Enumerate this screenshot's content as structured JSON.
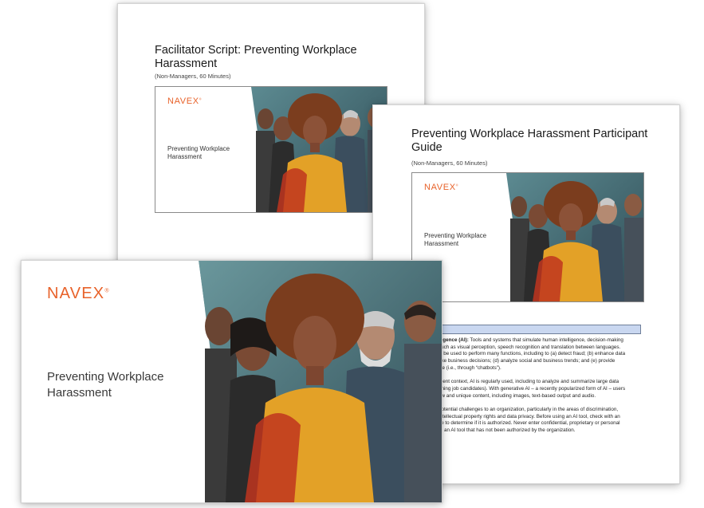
{
  "brand": {
    "logo_text": "NAVEX",
    "accent": "#e8622a"
  },
  "facilitator_script": {
    "title_line1": "Facilitator Script: Preventing Workplace",
    "title_line2": "Harassment",
    "subtitle": "(Non-Managers, 60 Minutes)",
    "cover_title_line1": "Preventing Workplace",
    "cover_title_line2": "Harassment"
  },
  "participant_guide": {
    "title_line1": "Preventing Workplace Harassment Participant",
    "title_line2": "Guide",
    "subtitle": "(Non-Managers, 60 Minutes)",
    "cover_title_line1": "Preventing Workplace",
    "cover_title_line2": "Harassment",
    "glossary": {
      "term": "lligence (AI):",
      "p1_l1": " Tools and systems that simulate human intelligence, decision-making",
      "p1_l2": "such as visual perception, speech recognition and translation between languages.",
      "p1_l3": "ly be used to perform many functions, including to (a) detect fraud; (b) enhance data",
      "p1_l4": "ake business decisions; (d) analyze social and business trends; and (e) provide",
      "p1_l5": "ice (i.e., through “chatbots”).",
      "p2_l1": "ment context, AI is regularly used, including to analyze and summarize large data",
      "p2_l2": "ening job candidates). With generative AI – a recently popularized form of AI – users",
      "p2_l3": "ew and unique content, including images, text-based output and audio.",
      "p3_l1": "potential challenges to an organization, particularly in the areas of discrimination,",
      "p3_l2": "intellectual property rights and data privacy. Before using an AI tool, check with an",
      "p3_l3": "ce to determine if it is authorized. Never enter confidential, proprietary or personal",
      "p3_l4": "to an AI tool that has not been authorized by the organization."
    }
  },
  "slide": {
    "title_line1": "Preventing Workplace",
    "title_line2": "Harassment"
  }
}
